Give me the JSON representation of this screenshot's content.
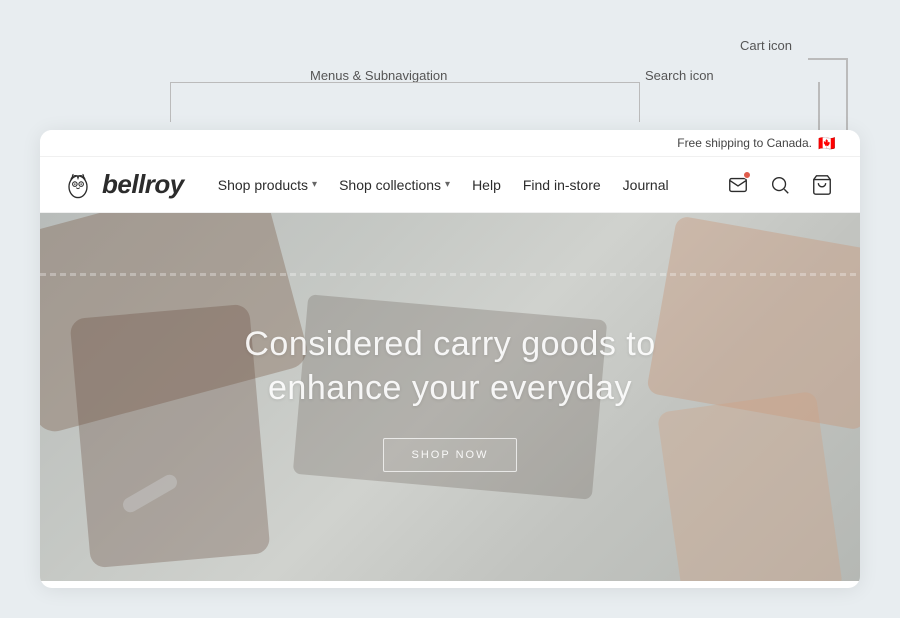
{
  "annotations": {
    "menus_label": "Menus & Subnavigation",
    "search_label": "Search icon",
    "cart_label": "Cart icon"
  },
  "topbar": {
    "shipping_text": "Free shipping to Canada.",
    "flag_emoji": "🇨🇦"
  },
  "nav": {
    "logo_text": "bellroy",
    "shop_products": "Shop products",
    "shop_collections": "Shop collections",
    "help": "Help",
    "find_in_store": "Find in-store",
    "journal": "Journal"
  },
  "hero": {
    "title_line1": "Considered carry goods to",
    "title_line2": "enhance your everyday",
    "cta_label": "SHOP NOW"
  }
}
